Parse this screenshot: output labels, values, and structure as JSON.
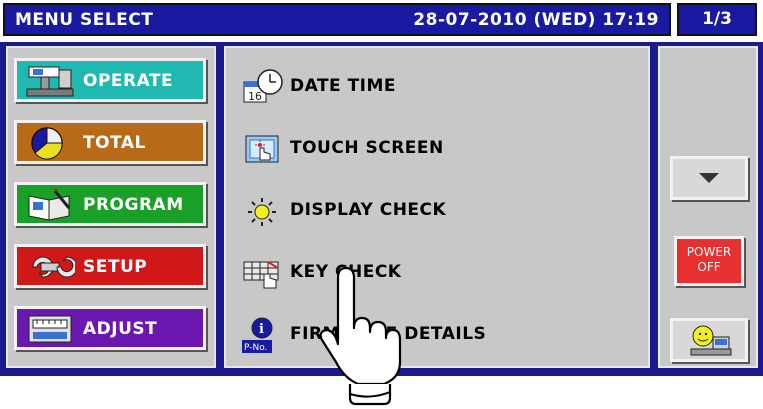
{
  "header": {
    "title": "MENU SELECT",
    "datetime": "28-07-2010 (WED) 17:19",
    "page": "1/3"
  },
  "categories": [
    {
      "label": "OPERATE",
      "color": "#20b8b0",
      "icon": "scale-icon"
    },
    {
      "label": "TOTAL",
      "color": "#b86a18",
      "icon": "pie-chart-icon"
    },
    {
      "label": "PROGRAM",
      "color": "#18a028",
      "icon": "book-icon"
    },
    {
      "label": "SETUP",
      "color": "#d01818",
      "icon": "wrench-icon"
    },
    {
      "label": "ADJUST",
      "color": "#6a18b0",
      "icon": "calibration-icon"
    }
  ],
  "menu_items": [
    {
      "label": "DATE TIME",
      "icon": "calendar-clock-icon"
    },
    {
      "label": "TOUCH SCREEN",
      "icon": "touch-screen-icon"
    },
    {
      "label": "DISPLAY CHECK",
      "icon": "sun-icon"
    },
    {
      "label": "KEY CHECK",
      "icon": "keyboard-icon"
    },
    {
      "label": "FIRMWARE DETAILS",
      "icon": "info-pno-icon",
      "info_tag": "P-No."
    }
  ],
  "right": {
    "power_line1": "POWER",
    "power_line2": "OFF"
  },
  "colors": {
    "title_bg": "#1a1aa0",
    "panel_bg": "#c8c8c8",
    "frame_bg": "#1a1a8c",
    "power_bg": "#e83030"
  }
}
